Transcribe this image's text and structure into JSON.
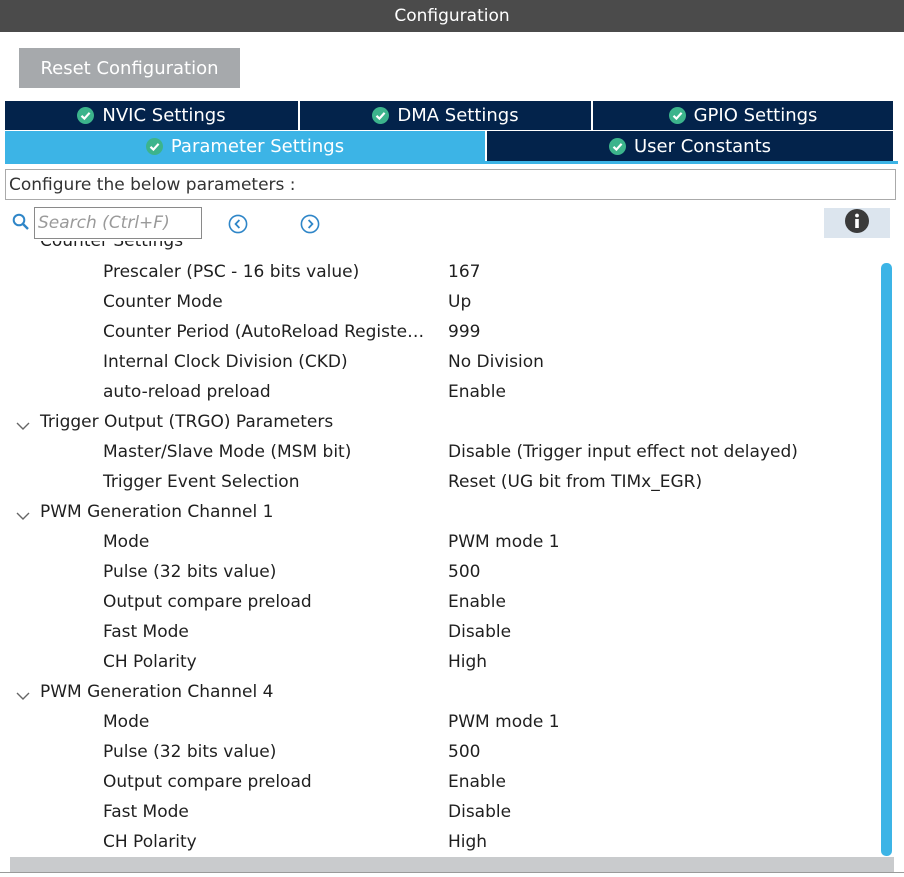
{
  "window": {
    "title": "Configuration"
  },
  "toolbar": {
    "reset_label": "Reset Configuration"
  },
  "tabs": [
    {
      "label": "NVIC Settings",
      "active": false
    },
    {
      "label": "DMA Settings",
      "active": false
    },
    {
      "label": "GPIO Settings",
      "active": false
    },
    {
      "label": "Parameter Settings",
      "active": true
    },
    {
      "label": "User Constants",
      "active": false
    }
  ],
  "description": "Configure the below parameters :",
  "search": {
    "placeholder": "Search (Ctrl+F)",
    "value": ""
  },
  "icons": {
    "search": "search-icon",
    "prev": "chevron-left-circle-icon",
    "next": "chevron-right-circle-icon",
    "info": "info-icon",
    "check": "check-circle-icon",
    "expand": "chevron-down-icon"
  },
  "colors": {
    "tab_inactive": "#03234b",
    "tab_active": "#3cb4e6",
    "check": "#3cb48c",
    "scroll_thumb": "#3cb4e6"
  },
  "tree": {
    "partial_group": "Counter Settings",
    "rows": [
      {
        "type": "param",
        "label": "Prescaler (PSC - 16 bits value)",
        "value": "167"
      },
      {
        "type": "param",
        "label": "Counter Mode",
        "value": "Up"
      },
      {
        "type": "param",
        "label": "Counter Period (AutoReload Registe…",
        "value": "999"
      },
      {
        "type": "param",
        "label": "Internal Clock Division (CKD)",
        "value": "No Division"
      },
      {
        "type": "param",
        "label": "auto-reload preload",
        "value": "Enable"
      },
      {
        "type": "group",
        "label": "Trigger Output (TRGO) Parameters"
      },
      {
        "type": "param",
        "label": "Master/Slave Mode (MSM bit)",
        "value": "Disable (Trigger input effect not delayed)"
      },
      {
        "type": "param",
        "label": "Trigger Event Selection",
        "value": "Reset (UG bit from TIMx_EGR)"
      },
      {
        "type": "group",
        "label": "PWM Generation Channel 1"
      },
      {
        "type": "param",
        "label": "Mode",
        "value": "PWM mode 1"
      },
      {
        "type": "param",
        "label": "Pulse (32 bits value)",
        "value": "500"
      },
      {
        "type": "param",
        "label": "Output compare preload",
        "value": "Enable"
      },
      {
        "type": "param",
        "label": "Fast Mode",
        "value": "Disable"
      },
      {
        "type": "param",
        "label": "CH Polarity",
        "value": "High"
      },
      {
        "type": "group",
        "label": "PWM Generation Channel 4"
      },
      {
        "type": "param",
        "label": "Mode",
        "value": "PWM mode 1"
      },
      {
        "type": "param",
        "label": "Pulse (32 bits value)",
        "value": "500"
      },
      {
        "type": "param",
        "label": "Output compare preload",
        "value": "Enable"
      },
      {
        "type": "param",
        "label": "Fast Mode",
        "value": "Disable"
      },
      {
        "type": "param",
        "label": "CH Polarity",
        "value": "High"
      }
    ]
  }
}
